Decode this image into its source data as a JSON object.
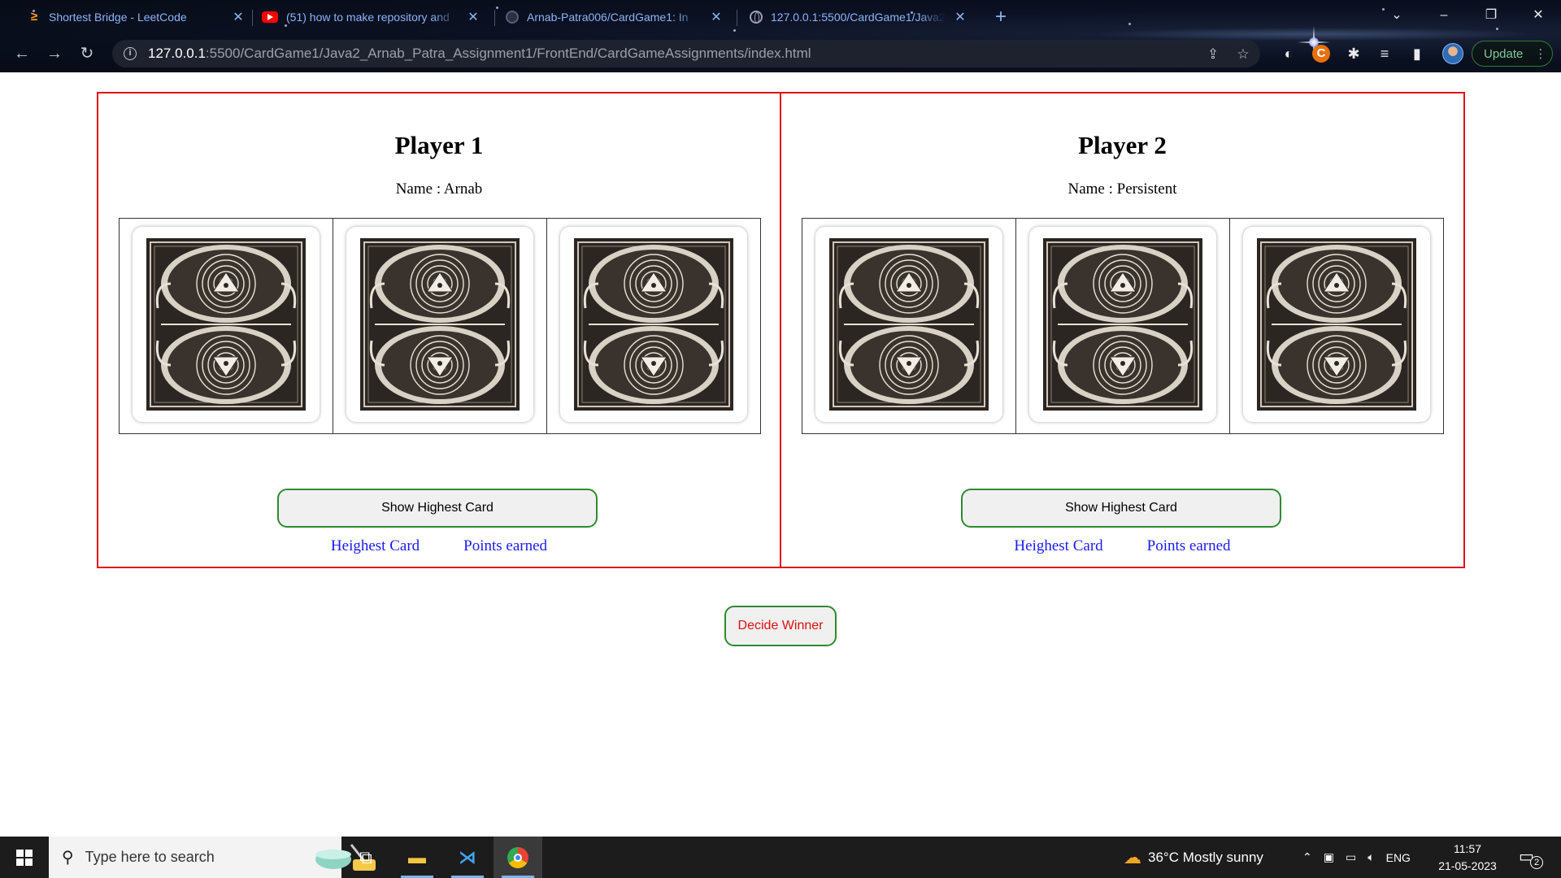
{
  "browser": {
    "tabs": [
      {
        "title": "Shortest Bridge - LeetCode",
        "favicon": "leetcode-icon"
      },
      {
        "title": "(51) how to make repository and",
        "favicon": "youtube-icon"
      },
      {
        "title": "Arnab-Patra006/CardGame1: In",
        "favicon": "github-icon"
      },
      {
        "title": "127.0.0.1:5500/CardGame1/Java2",
        "favicon": "globe-icon"
      }
    ],
    "url_host": "127.0.0.1",
    "url_path": ":5500/CardGame1/Java2_Arnab_Patra_Assignment1/FrontEnd/CardGameAssignments/index.html",
    "update_label": "Update",
    "new_tab_glyph": "+"
  },
  "players": [
    {
      "heading": "Player 1",
      "name_text": "Name : Arnab",
      "button_label": "Show Highest Card",
      "highest_card_label": "Heighest Card",
      "points_label": "Points earned"
    },
    {
      "heading": "Player 2",
      "name_text": "Name : Persistent",
      "button_label": "Show Highest Card",
      "highest_card_label": "Heighest Card",
      "points_label": "Points earned"
    }
  ],
  "decide_winner_label": "Decide Winner",
  "taskbar": {
    "search_placeholder": "Type here to search",
    "weather": "36°C  Mostly sunny",
    "language": "ENG",
    "time": "11:57",
    "date": "21-05-2023",
    "notification_count": "2"
  },
  "colors": {
    "panel_border": "#e01010",
    "button_border": "#2e8b2e",
    "link_text": "#1a1aff",
    "decide_text": "#e01010"
  }
}
